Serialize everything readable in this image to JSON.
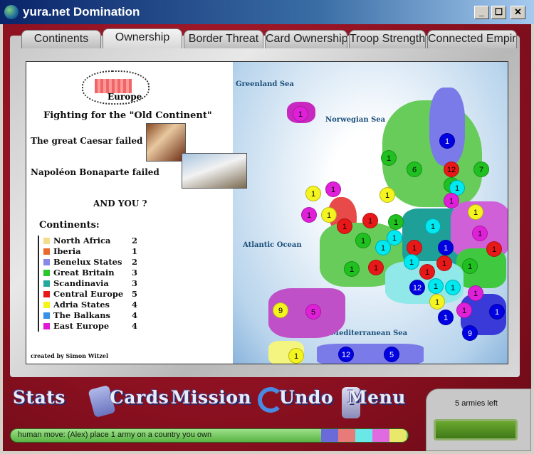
{
  "window": {
    "title": "yura.net Domination",
    "controls": [
      "_",
      "☐",
      "✕"
    ]
  },
  "tabs": [
    "Continents",
    "Ownership",
    "Border Threat",
    "Card Ownership",
    "Troop Strength",
    "Connected Empire"
  ],
  "active_tab": "Ownership",
  "map": {
    "banner": "Europe",
    "headline": "Fighting for the \"Old Continent\"",
    "caesar": "The great Caesar failed",
    "napoleon": "Napoléon Bonaparte failed",
    "and_you": "AND YOU ?",
    "continents_heading": "Continents:",
    "continents": [
      {
        "name": "North Africa",
        "bonus": "2",
        "color": "#f4dc8c"
      },
      {
        "name": "Iberia",
        "bonus": "1",
        "color": "#e86a2a"
      },
      {
        "name": "Benelux States",
        "bonus": "2",
        "color": "#8888e8"
      },
      {
        "name": "Great Britain",
        "bonus": "3",
        "color": "#2ac82a"
      },
      {
        "name": "Scandinavia",
        "bonus": "3",
        "color": "#22a8a0"
      },
      {
        "name": "Central Europe",
        "bonus": "5",
        "color": "#e81818"
      },
      {
        "name": "Adria States",
        "bonus": "4",
        "color": "#f4f418"
      },
      {
        "name": "The Balkans",
        "bonus": "4",
        "color": "#3890e8"
      },
      {
        "name": "East Europe",
        "bonus": "4",
        "color": "#e018d8"
      }
    ],
    "seas": {
      "greenland": "Greenland Sea",
      "norwegian": "Norwegian Sea",
      "atlantic": "Atlantic Ocean",
      "mediterranean": "Mediterranean Sea"
    },
    "credit": "created by Simon Witzel",
    "armies": [
      {
        "n": "1",
        "c": "#e020d8"
      },
      {
        "n": "1",
        "c": "#0000e0"
      },
      {
        "n": "1",
        "c": "#20c020"
      },
      {
        "n": "6",
        "c": "#20c020"
      },
      {
        "n": "12",
        "c": "#e81818"
      },
      {
        "n": "7",
        "c": "#20c020"
      },
      {
        "n": "1",
        "c": "#20c020"
      },
      {
        "n": "1",
        "c": "#00e8f0"
      },
      {
        "n": "1",
        "c": "#f4f420"
      },
      {
        "n": "1",
        "c": "#e020d8"
      },
      {
        "n": "1",
        "c": "#f4f420"
      },
      {
        "n": "1",
        "c": "#e020d8"
      },
      {
        "n": "1",
        "c": "#f4f420"
      },
      {
        "n": "1",
        "c": "#e81818"
      },
      {
        "n": "1",
        "c": "#e81818"
      },
      {
        "n": "1",
        "c": "#20c020"
      },
      {
        "n": "1",
        "c": "#20c020"
      },
      {
        "n": "1",
        "c": "#00e8f0"
      },
      {
        "n": "1",
        "c": "#f4f420"
      },
      {
        "n": "1",
        "c": "#e020d8"
      },
      {
        "n": "1",
        "c": "#00e8f0"
      },
      {
        "n": "1",
        "c": "#00e8f0"
      },
      {
        "n": "1",
        "c": "#e81818"
      },
      {
        "n": "1",
        "c": "#0000e0"
      },
      {
        "n": "1",
        "c": "#e81818"
      },
      {
        "n": "1",
        "c": "#20c020"
      },
      {
        "n": "1",
        "c": "#e81818"
      },
      {
        "n": "1",
        "c": "#00e8f0"
      },
      {
        "n": "1",
        "c": "#e81818"
      },
      {
        "n": "1",
        "c": "#e81818"
      },
      {
        "n": "1",
        "c": "#20c020"
      },
      {
        "n": "1",
        "c": "#0000e0"
      },
      {
        "n": "12",
        "c": "#00e8f0"
      },
      {
        "n": "1",
        "c": "#00e8f0"
      },
      {
        "n": "1",
        "c": "#e020d8"
      },
      {
        "n": "1",
        "c": "#f4f420"
      },
      {
        "n": "1",
        "c": "#0000e0"
      },
      {
        "n": "1",
        "c": "#e020d8"
      },
      {
        "n": "1",
        "c": "#0000e0"
      },
      {
        "n": "1",
        "c": "#0000e0"
      },
      {
        "n": "9",
        "c": "#f4f420"
      },
      {
        "n": "9",
        "c": "#e020d8"
      },
      {
        "n": "5",
        "c": "#f4f420"
      },
      {
        "n": "1",
        "c": "#0000e0"
      },
      {
        "n": "12",
        "c": "#0000e0"
      },
      {
        "n": "5",
        "c": "#e020d8"
      }
    ]
  },
  "buttons": {
    "stats": "Stats",
    "cards": "Cards",
    "mission": "Mission",
    "undo": "Undo",
    "menu": "Menu"
  },
  "status": {
    "message": "human move: (Alex) place 1 army on a country you own",
    "player_colors": [
      "#6a6ad8",
      "#e87a7a",
      "#6ae8e8",
      "#e06ae0",
      "#e8e86a"
    ]
  },
  "armies_left": "5 armies left"
}
